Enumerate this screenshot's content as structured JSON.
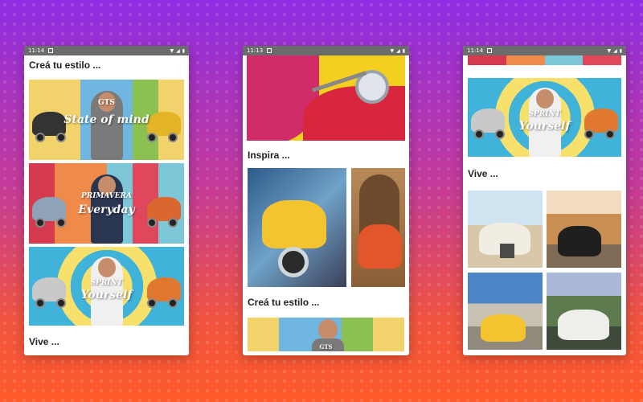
{
  "phones": [
    {
      "status_time": "11:14",
      "title_top": "Creá tu estilo ...",
      "banners": [
        {
          "line1": "GTS",
          "line2": "State of mind"
        },
        {
          "line1": "PRIMAVERA",
          "line2": "Everyday"
        },
        {
          "line1": "SPRINT",
          "line2": "Yourself"
        }
      ],
      "title_bottom": "Vive ..."
    },
    {
      "status_time": "11:13",
      "title_inspira": "Inspira ...",
      "title_crea": "Creá tu estilo ...",
      "banner_gts": "GTS"
    },
    {
      "status_time": "11:14",
      "banner": {
        "line1": "SPRINT",
        "line2": "Yourself"
      },
      "title_vive": "Vive ..."
    }
  ],
  "colors": {
    "bg_top": "#8e2de2",
    "bg_bottom": "#ff5a2a",
    "vespa_red": "#d7263d",
    "vespa_yellow": "#f4c430"
  }
}
